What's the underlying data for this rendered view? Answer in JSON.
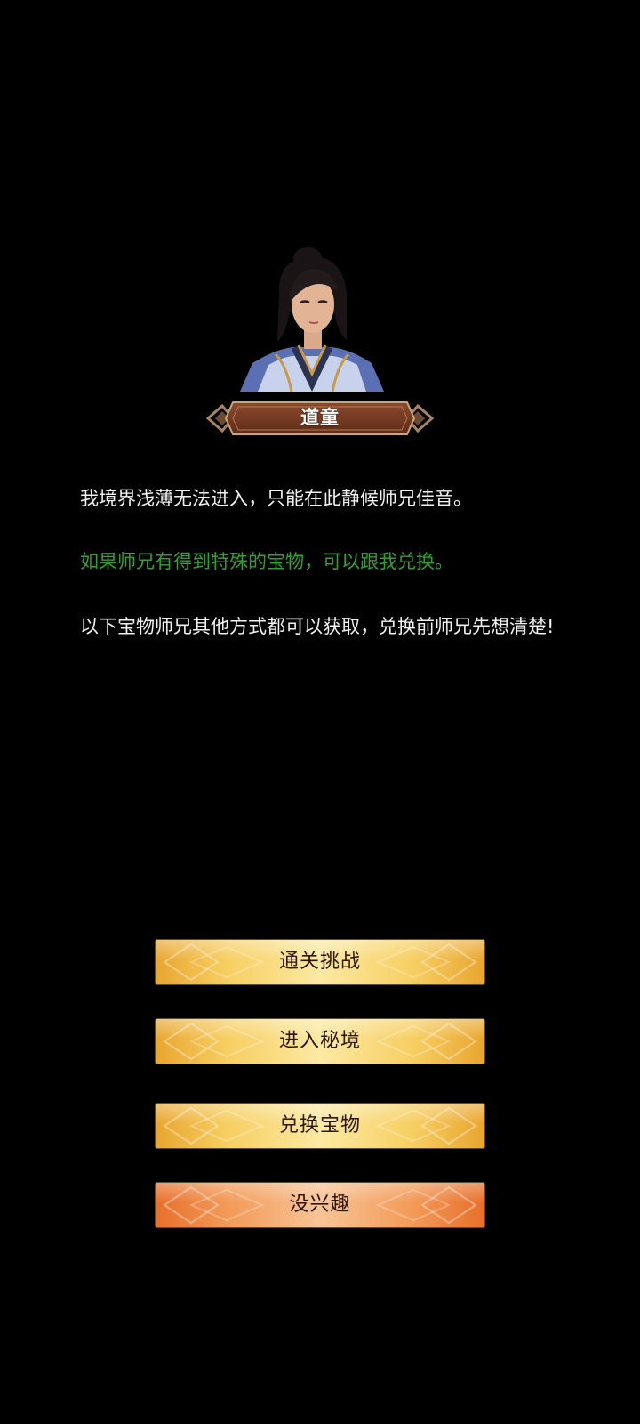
{
  "npc": {
    "name": "道童",
    "portrait_icon": "young-taoist-portrait"
  },
  "dialogue": {
    "line1": "我境界浅薄无法进入，只能在此静候师兄佳音。",
    "line2": "如果师兄有得到特殊的宝物，可以跟我兑换。",
    "line3": "以下宝物师兄其他方式都可以获取，兑换前师兄先想清楚!"
  },
  "options": [
    {
      "label": "通关挑战",
      "style": "gold"
    },
    {
      "label": "进入秘境",
      "style": "gold"
    },
    {
      "label": "兑换宝物",
      "style": "gold"
    },
    {
      "label": "没兴趣",
      "style": "orange"
    }
  ],
  "colors": {
    "background": "#000000",
    "highlight_text": "#2fa22f",
    "button_gold": "#f7cf63",
    "button_orange": "#f39a58",
    "nameplate": "#7a3e26"
  }
}
